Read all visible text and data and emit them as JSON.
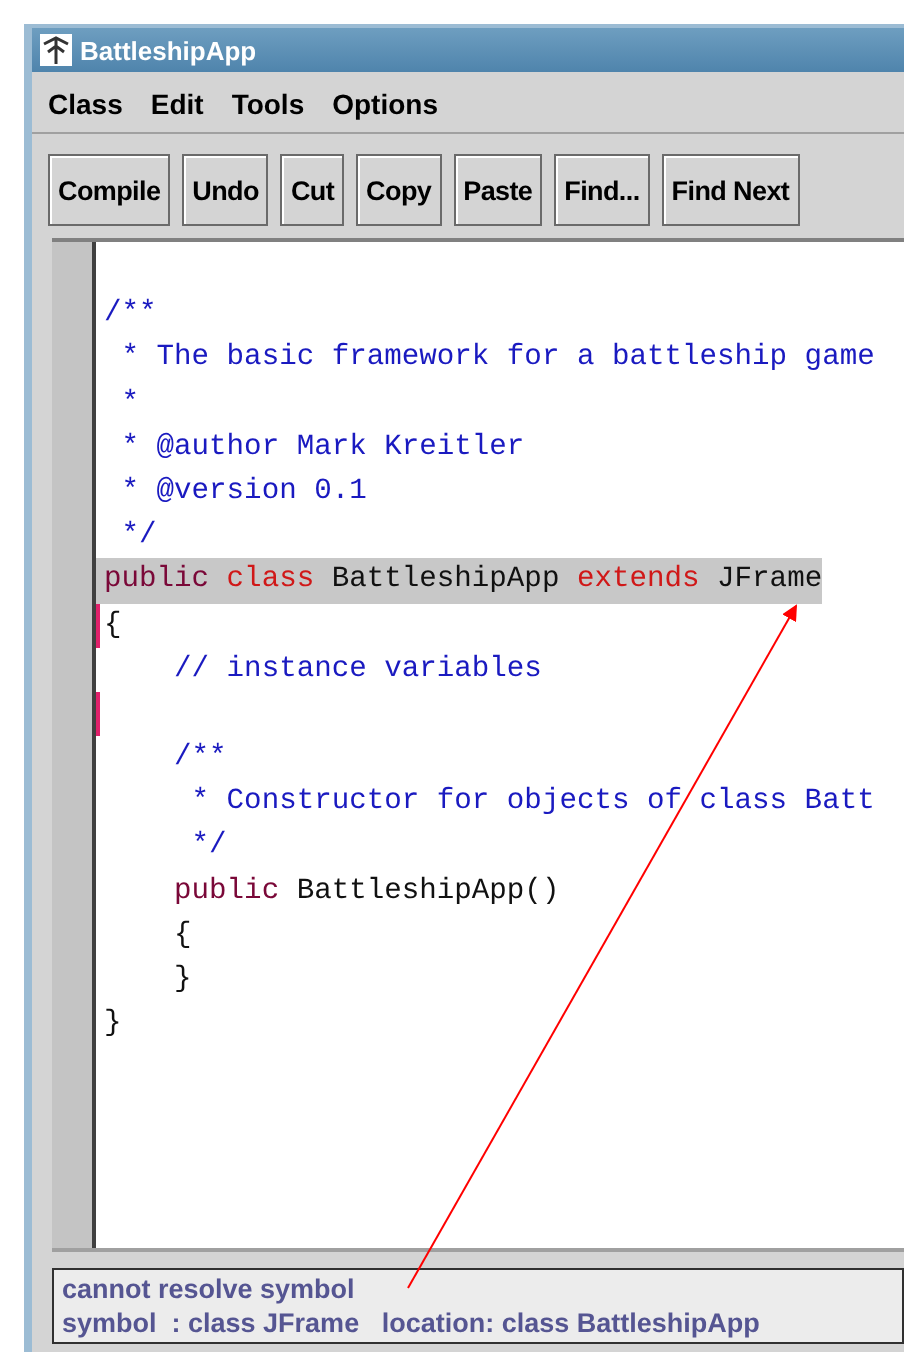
{
  "window": {
    "title": "BattleshipApp"
  },
  "menu": [
    "Class",
    "Edit",
    "Tools",
    "Options"
  ],
  "toolbar": [
    "Compile",
    "Undo",
    "Cut",
    "Copy",
    "Paste",
    "Find...",
    "Find Next"
  ],
  "code": {
    "lines": [
      {
        "highlighted": false,
        "marker": false
      },
      {
        "tokens": [
          {
            "text": "/**",
            "kind": "comment"
          }
        ],
        "highlighted": false,
        "marker": false
      },
      {
        "tokens": [
          {
            "text": " * The basic framework for a battleship game",
            "kind": "comment"
          }
        ],
        "highlighted": false,
        "marker": false
      },
      {
        "tokens": [
          {
            "text": " *",
            "kind": "comment"
          }
        ],
        "highlighted": false,
        "marker": false
      },
      {
        "tokens": [
          {
            "text": " * @author Mark Kreitler",
            "kind": "comment"
          }
        ],
        "highlighted": false,
        "marker": false
      },
      {
        "tokens": [
          {
            "text": " * @version 0.1",
            "kind": "comment"
          }
        ],
        "highlighted": false,
        "marker": false
      },
      {
        "tokens": [
          {
            "text": " */",
            "kind": "comment"
          }
        ],
        "highlighted": false,
        "marker": false
      },
      {
        "tokens": [
          {
            "text": "public",
            "kind": "modifier"
          },
          {
            "text": " class",
            "kind": "keyword"
          },
          {
            "text": " BattleshipApp ",
            "kind": "plain"
          },
          {
            "text": "extends",
            "kind": "keyword"
          },
          {
            "text": " JFrame",
            "kind": "plain"
          }
        ],
        "highlighted": true,
        "marker": false
      },
      {
        "tokens": [
          {
            "text": "{",
            "kind": "plain"
          }
        ],
        "highlighted": false,
        "marker": true
      },
      {
        "tokens": [
          {
            "text": "    // instance variables",
            "kind": "comment"
          }
        ],
        "highlighted": false,
        "marker": false
      },
      {
        "highlighted": false,
        "marker": true
      },
      {
        "tokens": [
          {
            "text": "    /**",
            "kind": "comment"
          }
        ],
        "highlighted": false,
        "marker": false
      },
      {
        "tokens": [
          {
            "text": "     * Constructor for objects of class Batt",
            "kind": "comment"
          }
        ],
        "highlighted": false,
        "marker": false
      },
      {
        "tokens": [
          {
            "text": "     */",
            "kind": "comment"
          }
        ],
        "highlighted": false,
        "marker": false
      },
      {
        "tokens": [
          {
            "text": "    public",
            "kind": "modifier"
          },
          {
            "text": " BattleshipApp()",
            "kind": "plain"
          }
        ],
        "highlighted": false,
        "marker": false
      },
      {
        "tokens": [
          {
            "text": "    {",
            "kind": "plain"
          }
        ],
        "highlighted": false,
        "marker": false
      },
      {
        "tokens": [
          {
            "text": "    }",
            "kind": "plain"
          }
        ],
        "highlighted": false,
        "marker": false
      },
      {
        "tokens": [
          {
            "text": "}",
            "kind": "plain"
          }
        ],
        "highlighted": false,
        "marker": false
      }
    ]
  },
  "status": {
    "message": "cannot resolve symbol",
    "detail": "symbol  : class JFrame   location: class BattleshipApp"
  }
}
